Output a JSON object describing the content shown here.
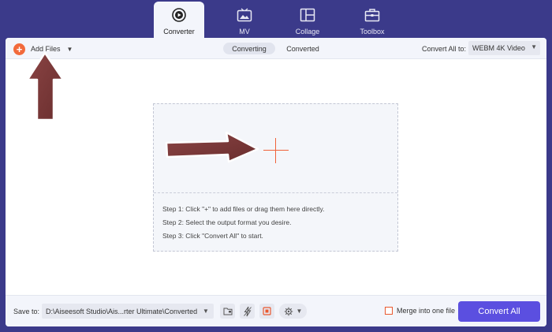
{
  "nav": {
    "tabs": [
      {
        "label": "Converter",
        "icon": "converter-icon",
        "active": true
      },
      {
        "label": "MV",
        "icon": "mv-icon",
        "active": false
      },
      {
        "label": "Collage",
        "icon": "collage-icon",
        "active": false
      },
      {
        "label": "Toolbox",
        "icon": "toolbox-icon",
        "active": false
      }
    ]
  },
  "toolbar": {
    "add_files_label": "Add Files",
    "segments": [
      {
        "label": "Converting",
        "active": true
      },
      {
        "label": "Converted",
        "active": false
      }
    ],
    "convert_all_to_label": "Convert All to:",
    "format_value": "WEBM 4K Video"
  },
  "drop": {
    "steps": [
      "Step 1: Click \"+\" to add files or drag them here directly.",
      "Step 2: Select the output format you desire.",
      "Step 3: Click \"Convert All\" to start."
    ]
  },
  "bottom": {
    "save_to_label": "Save to:",
    "path_value": "D:\\Aiseesoft Studio\\Ais...rter Ultimate\\Converted",
    "merge_label": "Merge into one file",
    "merge_checked": false,
    "convert_all_label": "Convert All"
  },
  "colors": {
    "frame": "#3b3a8a",
    "accent_orange": "#f26a3b",
    "convert_button": "#5b4fe0",
    "annotation_arrow": "#7a3838"
  }
}
